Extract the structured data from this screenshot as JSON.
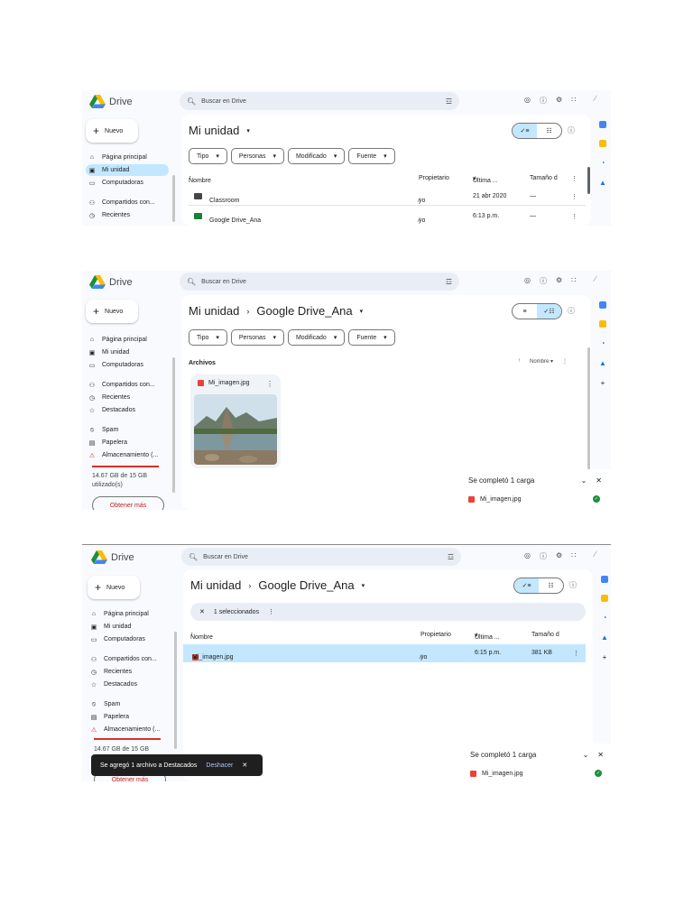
{
  "app": {
    "name": "Drive"
  },
  "colors": {
    "accent": "#c2e7ff",
    "danger": "#d93025",
    "success": "#1e8e3e"
  },
  "search": {
    "placeholder": "Buscar en Drive"
  },
  "nav": {
    "new_label": "Nuevo",
    "items": [
      "Página principal",
      "Mi unidad",
      "Computadoras",
      "Compartidos con...",
      "Recientes",
      "Destacados",
      "Spam",
      "Papelera",
      "Almacenamiento (..."
    ],
    "storage_text": "14.67 GB de 15 GB utilizado(s)",
    "storage_text_short": "14.67 GB de 15 GB",
    "get_more": "Obtener más"
  },
  "filters": [
    "Tipo",
    "Personas",
    "Modificado",
    "Fuente"
  ],
  "shot1": {
    "title": "Mi unidad",
    "columns": {
      "name": "Nombre",
      "owner": "Propietario",
      "modified": "Última ...",
      "size": "Tamaño d"
    },
    "rows": [
      {
        "name": "Classroom",
        "owner": "yo",
        "modified": "21 abr 2020",
        "size": "—",
        "color": "#444746"
      },
      {
        "name": "Google Drive_Ana",
        "owner": "yo",
        "modified": "6:13 p.m.",
        "size": "—",
        "color": "#188038"
      }
    ]
  },
  "shot2": {
    "breadcrumb_root": "Mi unidad",
    "breadcrumb_current": "Google Drive_Ana",
    "section": "Archivos",
    "sort_label": "Nombre",
    "file": {
      "name": "Mi_imagen.jpg"
    },
    "upload": {
      "title": "Se completó 1 carga",
      "file": "Mi_imagen.jpg"
    }
  },
  "shot3": {
    "breadcrumb_root": "Mi unidad",
    "breadcrumb_current": "Google Drive_Ana",
    "selected": "1 seleccionados",
    "columns": {
      "name": "Nombre",
      "owner": "Propietario",
      "modified": "Última ...",
      "size": "Tamaño d"
    },
    "row": {
      "name": "Mi_imagen.jpg",
      "owner": "yo",
      "modified": "6:15 p.m.",
      "size": "381 KB"
    },
    "toast": {
      "message": "Se agregó 1 archivo a Destacados",
      "action": "Deshacer"
    },
    "upload": {
      "title": "Se completó 1 carga",
      "file": "Mi_imagen.jpg"
    }
  }
}
